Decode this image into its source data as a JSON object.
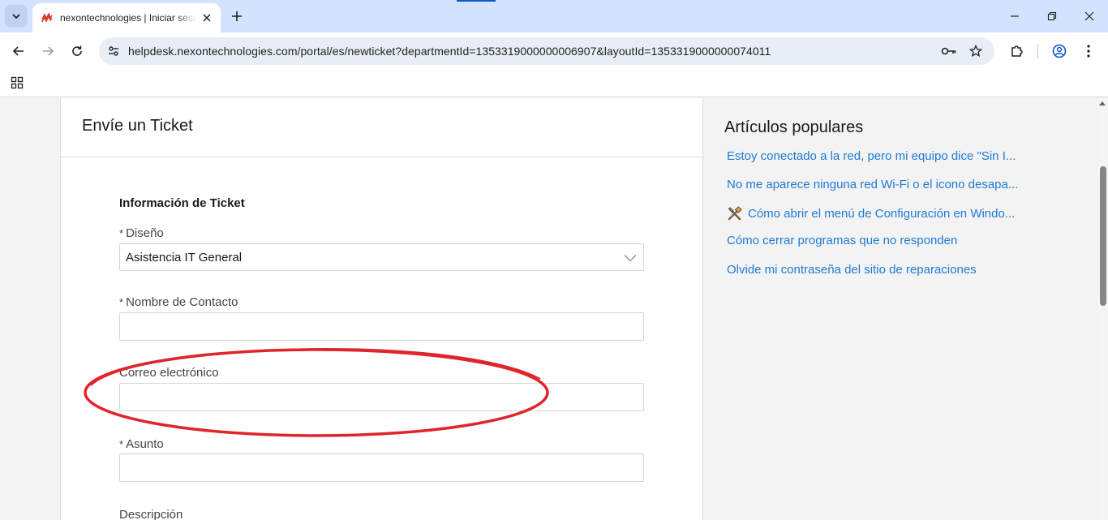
{
  "browser": {
    "tab": {
      "title": "nexontechnologies | Iniciar sesión"
    },
    "address_bar": {
      "url": "helpdesk.nexontechnologies.com/portal/es/newticket?departmentId=1353319000000006907&layoutId=1353319000000074011"
    },
    "icons": {
      "tab_search": "chevron-down-icon",
      "new_tab": "plus-icon",
      "minimize": "minimize-icon",
      "restore": "restore-icon",
      "close": "close-icon",
      "back": "arrow-left-icon",
      "forward": "arrow-right-icon",
      "reload": "reload-icon",
      "site_info": "tune-icon",
      "password": "key-icon",
      "bookmark": "star-icon",
      "extensions": "puzzle-icon",
      "profile": "person-icon",
      "menu": "kebab-icon",
      "apps": "apps-grid-icon"
    }
  },
  "ticket_form": {
    "title": "Envíe un Ticket",
    "section_title": "Información de Ticket",
    "required_mark": "*",
    "fields": {
      "layout": {
        "label": "Diseño",
        "value": "Asistencia IT General"
      },
      "contact_name": {
        "label": "Nombre de Contacto",
        "value": ""
      },
      "email": {
        "label": "Correo electrónico",
        "value": ""
      },
      "subject": {
        "label": "Asunto",
        "value": ""
      },
      "description": {
        "label": "Descripción"
      }
    }
  },
  "sidebar": {
    "title": "Artículos populares",
    "articles": [
      {
        "text": "Estoy conectado a la red, pero mi equipo dice \"Sin I..."
      },
      {
        "text": "No me aparece ninguna red Wi-Fi o el icono desapa..."
      },
      {
        "text": "Cómo abrir el menú de Configuración en Windo...",
        "icon": "tools-icon"
      },
      {
        "text": "Cómo cerrar programas que no responden"
      },
      {
        "text": "Olvide mi contraseña del sitio de reparaciones"
      }
    ]
  },
  "colors": {
    "tabstrip": "#d3e3fd",
    "omnibox": "#e9eef6",
    "link": "#1e7ad6",
    "annotation": "#e0242c"
  }
}
